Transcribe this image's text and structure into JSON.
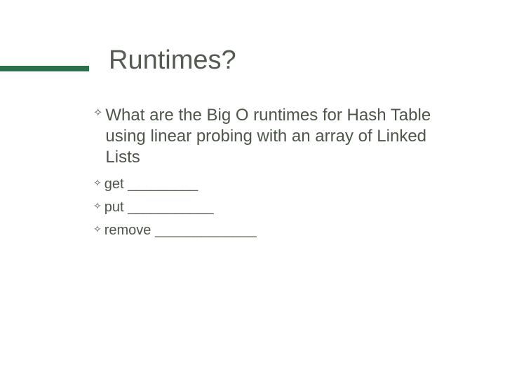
{
  "slide": {
    "title": "Runtimes?",
    "main_bullet": "What are the Big O runtimes for Hash Table using linear probing with an array of Linked Lists",
    "sub_bullets": [
      "get  _________",
      "put  ___________",
      "remove  _____________"
    ]
  },
  "accent_color": "#2d6e4c"
}
